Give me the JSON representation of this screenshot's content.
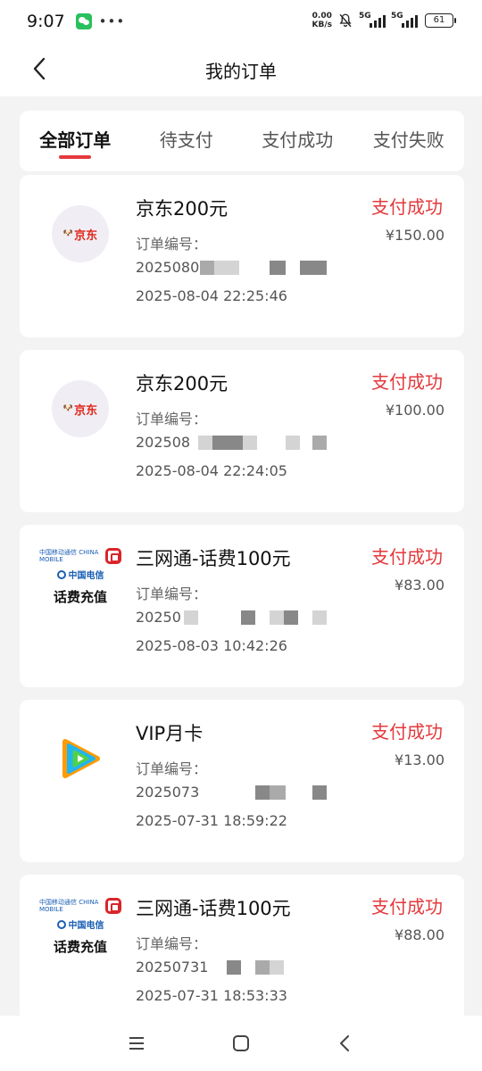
{
  "status_bar": {
    "time": "9:07",
    "net_speed_value": "0.00",
    "net_speed_unit": "KB/s",
    "sim1_label": "5G",
    "sim2_label": "5G",
    "battery": "61"
  },
  "header": {
    "title": "我的订单"
  },
  "tabs": [
    {
      "label": "全部订单",
      "active": true
    },
    {
      "label": "待支付",
      "active": false
    },
    {
      "label": "支付成功",
      "active": false
    },
    {
      "label": "支付失败",
      "active": false
    }
  ],
  "orders": [
    {
      "logo": "jd-logo",
      "logo_text": "京东",
      "product": "京东200元",
      "order_label": "订单编号：",
      "order_no_visible": "2025080",
      "order_time": "2025-08-04 22:25:46",
      "status": "支付成功",
      "price": "¥150.00"
    },
    {
      "logo": "jd-logo",
      "logo_text": "京东",
      "product": "京东200元",
      "order_label": "订单编号：",
      "order_no_visible": "202508",
      "order_time": "2025-08-04 22:24:05",
      "status": "支付成功",
      "price": "¥100.00"
    },
    {
      "logo": "telecom-logo",
      "logo_caption": "话费充值",
      "logo_cm": "中国移动通信 CHINA MOBILE",
      "logo_cu": "China unicom中国联通",
      "logo_ct": "中国电信",
      "product": "三网通-话费100元",
      "order_label": "订单编号：",
      "order_no_visible": "20250",
      "order_time": "2025-08-03 10:42:26",
      "status": "支付成功",
      "price": "¥83.00"
    },
    {
      "logo": "tencent-video-logo",
      "product": "VIP月卡",
      "order_label": "订单编号：",
      "order_no_visible": "2025073",
      "order_time": "2025-07-31 18:59:22",
      "status": "支付成功",
      "price": "¥13.00"
    },
    {
      "logo": "telecom-logo",
      "logo_caption": "话费充值",
      "logo_cm": "中国移动通信 CHINA MOBILE",
      "logo_cu": "China unicom中国联通",
      "logo_ct": "中国电信",
      "product": "三网通-话费100元",
      "order_label": "订单编号：",
      "order_no_visible": "20250731",
      "order_time": "2025-07-31 18:53:33",
      "status": "支付成功",
      "price": "¥88.00"
    }
  ],
  "colors": {
    "accent": "#e4393c",
    "background": "#f3f3f3"
  },
  "nav_bar": {
    "icons": [
      "menu-icon",
      "home-icon",
      "back-icon"
    ]
  }
}
